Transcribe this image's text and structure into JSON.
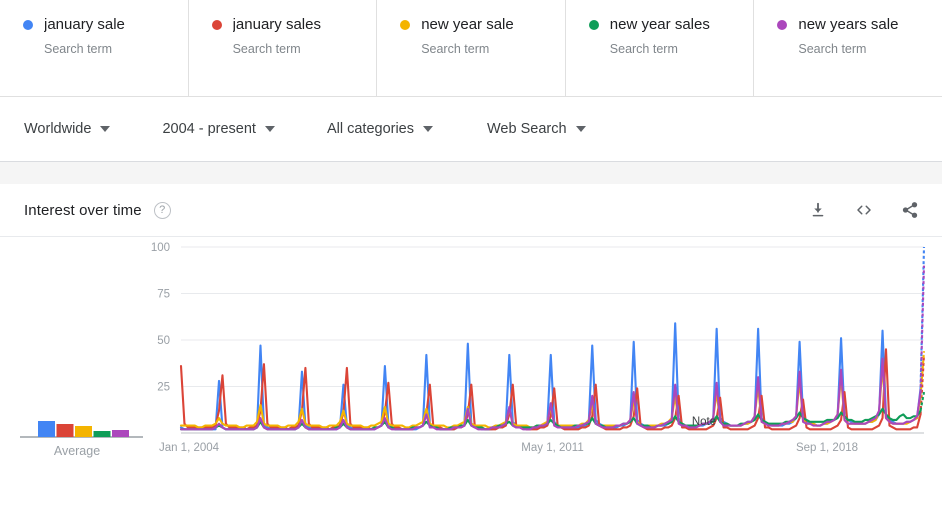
{
  "terms": [
    {
      "name": "january sale",
      "type": "Search term",
      "color": "#4285F4",
      "dot": "legend-dot"
    },
    {
      "name": "january sales",
      "type": "Search term",
      "color": "#DB4437",
      "dot": "legend-dot"
    },
    {
      "name": "new year sale",
      "type": "Search term",
      "color": "#F4B400",
      "dot": "legend-dot"
    },
    {
      "name": "new year sales",
      "type": "Search term",
      "color": "#0F9D58",
      "dot": "legend-dot"
    },
    {
      "name": "new years sale",
      "type": "Search term",
      "color": "#AB47BC",
      "dot": "legend-dot"
    }
  ],
  "filters": [
    {
      "label": "Worldwide",
      "icon": "chevron-down-icon"
    },
    {
      "label": "2004 - present",
      "icon": "chevron-down-icon"
    },
    {
      "label": "All categories",
      "icon": "chevron-down-icon"
    },
    {
      "label": "Web Search",
      "icon": "chevron-down-icon"
    }
  ],
  "card": {
    "title": "Interest over time",
    "help": "?",
    "actions": [
      {
        "name": "download-icon",
        "tooltip": "Download"
      },
      {
        "name": "embed-code-icon",
        "tooltip": "Embed"
      },
      {
        "name": "share-icon",
        "tooltip": "Share"
      }
    ]
  },
  "chart_data": {
    "type": "line",
    "title": "Interest over time",
    "xlabel": "",
    "ylabel": "",
    "ylim": [
      0,
      100
    ],
    "yticks": [
      25,
      50,
      75,
      100
    ],
    "grid": true,
    "legend_position": "top",
    "note_annotation": "Note",
    "axis_ticks": [
      "Jan 1, 2004",
      "May 1, 2011",
      "Sep 1, 2018"
    ],
    "x_start": "Jan 1, 2004",
    "x_end": "2021",
    "average_panel": {
      "label": "Average",
      "values": [
        16,
        13,
        11,
        6,
        7
      ]
    },
    "series": [
      {
        "name": "january sale",
        "color": "#4285F4",
        "peaks": [
          28,
          47,
          33,
          26,
          36,
          42,
          48,
          42,
          42,
          47,
          49,
          59,
          56,
          56,
          49,
          51,
          55,
          100
        ],
        "baseline": 3,
        "values": [
          3,
          2,
          2,
          3,
          2,
          2,
          2,
          2,
          2,
          2,
          2,
          28,
          3,
          2,
          2,
          2,
          2,
          2,
          2,
          2,
          2,
          2,
          3,
          47,
          4,
          3,
          2,
          2,
          2,
          2,
          2,
          2,
          2,
          2,
          3,
          33,
          4,
          3,
          2,
          2,
          2,
          2,
          2,
          2,
          2,
          2,
          3,
          26,
          4,
          3,
          2,
          2,
          2,
          2,
          2,
          2,
          2,
          3,
          4,
          36,
          5,
          3,
          2,
          2,
          2,
          2,
          2,
          2,
          2,
          3,
          4,
          42,
          5,
          3,
          3,
          2,
          2,
          2,
          2,
          2,
          3,
          3,
          4,
          48,
          5,
          4,
          3,
          2,
          2,
          2,
          2,
          3,
          3,
          3,
          5,
          42,
          6,
          4,
          3,
          3,
          2,
          2,
          3,
          3,
          3,
          4,
          5,
          42,
          6,
          4,
          3,
          3,
          3,
          3,
          3,
          3,
          4,
          4,
          6,
          47,
          7,
          5,
          4,
          3,
          3,
          3,
          3,
          4,
          4,
          5,
          6,
          49,
          7,
          5,
          4,
          3,
          3,
          3,
          4,
          4,
          4,
          5,
          7,
          59,
          8,
          5,
          4,
          4,
          3,
          3,
          4,
          4,
          5,
          5,
          7,
          56,
          8,
          6,
          5,
          4,
          4,
          4,
          4,
          5,
          5,
          6,
          8,
          56,
          8,
          6,
          5,
          4,
          4,
          4,
          4,
          5,
          5,
          6,
          8,
          49,
          9,
          6,
          5,
          5,
          4,
          4,
          5,
          5,
          6,
          7,
          9,
          51,
          9,
          7,
          6,
          5,
          5,
          5,
          5,
          6,
          6,
          7,
          10,
          55,
          10,
          7,
          6,
          5,
          5,
          5,
          6,
          6,
          7,
          8,
          24,
          100
        ]
      },
      {
        "name": "january sales",
        "color": "#DB4437",
        "peaks": [
          36,
          31,
          37,
          35,
          35,
          27,
          26,
          26,
          26,
          24,
          26,
          24,
          20,
          19,
          20,
          18,
          22,
          45
        ],
        "baseline": 3,
        "values": [
          36,
          5,
          3,
          3,
          3,
          3,
          3,
          3,
          3,
          3,
          4,
          12,
          31,
          5,
          3,
          3,
          3,
          3,
          3,
          2,
          3,
          3,
          4,
          12,
          37,
          5,
          3,
          3,
          3,
          3,
          3,
          2,
          3,
          3,
          4,
          12,
          35,
          5,
          3,
          3,
          3,
          3,
          3,
          2,
          3,
          3,
          4,
          11,
          35,
          5,
          3,
          3,
          3,
          3,
          3,
          2,
          3,
          3,
          4,
          11,
          27,
          5,
          3,
          3,
          2,
          2,
          2,
          2,
          3,
          3,
          4,
          10,
          26,
          4,
          3,
          3,
          2,
          2,
          2,
          2,
          3,
          3,
          4,
          10,
          26,
          4,
          3,
          3,
          2,
          2,
          2,
          2,
          3,
          3,
          4,
          10,
          26,
          4,
          3,
          3,
          2,
          2,
          2,
          2,
          3,
          3,
          4,
          9,
          24,
          4,
          3,
          2,
          2,
          2,
          2,
          2,
          3,
          3,
          4,
          9,
          26,
          4,
          3,
          2,
          2,
          2,
          2,
          2,
          3,
          3,
          4,
          9,
          24,
          4,
          3,
          2,
          2,
          2,
          2,
          2,
          3,
          3,
          4,
          8,
          20,
          3,
          3,
          2,
          2,
          2,
          2,
          2,
          2,
          3,
          4,
          8,
          19,
          3,
          3,
          2,
          2,
          2,
          2,
          2,
          2,
          3,
          4,
          8,
          20,
          3,
          3,
          2,
          2,
          2,
          2,
          2,
          2,
          3,
          4,
          8,
          18,
          3,
          2,
          2,
          2,
          2,
          2,
          2,
          2,
          3,
          4,
          7,
          22,
          3,
          2,
          2,
          2,
          2,
          2,
          2,
          2,
          3,
          4,
          8,
          45,
          4,
          3,
          2,
          2,
          2,
          2,
          2,
          3,
          3,
          10,
          42
        ]
      },
      {
        "name": "new year sale",
        "color": "#F4B400",
        "peaks": [
          8,
          15,
          13,
          12,
          14,
          13,
          14,
          13,
          14,
          16,
          18,
          20,
          22,
          25,
          28,
          30,
          36,
          44
        ],
        "baseline": 4,
        "values": [
          4,
          4,
          4,
          4,
          4,
          3,
          3,
          4,
          4,
          4,
          5,
          8,
          5,
          4,
          4,
          4,
          4,
          3,
          3,
          4,
          4,
          4,
          6,
          15,
          5,
          4,
          4,
          4,
          4,
          3,
          3,
          4,
          4,
          4,
          6,
          13,
          5,
          4,
          4,
          4,
          4,
          3,
          3,
          4,
          4,
          4,
          6,
          12,
          5,
          4,
          4,
          4,
          4,
          3,
          3,
          4,
          4,
          5,
          6,
          14,
          5,
          4,
          4,
          4,
          4,
          3,
          3,
          4,
          4,
          5,
          6,
          13,
          5,
          4,
          4,
          4,
          4,
          3,
          3,
          4,
          4,
          5,
          6,
          14,
          5,
          4,
          4,
          4,
          4,
          3,
          3,
          4,
          4,
          5,
          6,
          13,
          5,
          4,
          4,
          4,
          4,
          3,
          3,
          4,
          4,
          5,
          6,
          14,
          5,
          4,
          4,
          4,
          4,
          4,
          4,
          4,
          5,
          5,
          7,
          16,
          5,
          4,
          4,
          4,
          4,
          4,
          4,
          4,
          5,
          5,
          7,
          18,
          6,
          4,
          4,
          4,
          4,
          4,
          4,
          5,
          5,
          6,
          8,
          20,
          6,
          5,
          4,
          4,
          4,
          4,
          4,
          5,
          5,
          6,
          8,
          22,
          6,
          5,
          4,
          4,
          4,
          4,
          4,
          5,
          5,
          6,
          9,
          25,
          6,
          5,
          5,
          4,
          4,
          4,
          5,
          5,
          6,
          6,
          9,
          28,
          7,
          5,
          5,
          5,
          4,
          4,
          5,
          5,
          6,
          7,
          10,
          30,
          7,
          5,
          5,
          5,
          5,
          5,
          5,
          6,
          6,
          7,
          11,
          36,
          8,
          6,
          5,
          5,
          5,
          5,
          5,
          6,
          7,
          8,
          20,
          44
        ]
      },
      {
        "name": "new year sales",
        "color": "#0F9D58",
        "peaks": [
          4,
          6,
          5,
          5,
          6,
          6,
          7,
          6,
          7,
          8,
          8,
          9,
          9,
          10,
          11,
          11,
          13,
          22
        ],
        "baseline": 3,
        "values": [
          2,
          2,
          2,
          2,
          2,
          2,
          2,
          2,
          2,
          2,
          3,
          4,
          3,
          2,
          2,
          2,
          2,
          2,
          2,
          2,
          2,
          2,
          3,
          6,
          3,
          2,
          2,
          2,
          2,
          2,
          2,
          2,
          2,
          2,
          3,
          5,
          3,
          2,
          2,
          2,
          2,
          2,
          2,
          2,
          2,
          3,
          3,
          5,
          3,
          2,
          2,
          2,
          2,
          2,
          2,
          2,
          3,
          3,
          4,
          6,
          3,
          3,
          2,
          2,
          2,
          2,
          2,
          3,
          3,
          3,
          4,
          6,
          4,
          3,
          3,
          2,
          2,
          2,
          3,
          3,
          3,
          4,
          4,
          7,
          4,
          3,
          3,
          3,
          2,
          2,
          3,
          3,
          4,
          4,
          5,
          6,
          4,
          3,
          3,
          3,
          3,
          3,
          3,
          4,
          4,
          4,
          5,
          7,
          5,
          4,
          3,
          3,
          3,
          3,
          4,
          4,
          4,
          5,
          5,
          8,
          5,
          4,
          4,
          3,
          3,
          3,
          4,
          4,
          5,
          5,
          6,
          8,
          5,
          4,
          4,
          4,
          3,
          3,
          4,
          4,
          5,
          5,
          6,
          9,
          6,
          5,
          4,
          4,
          4,
          4,
          4,
          5,
          5,
          6,
          6,
          9,
          6,
          5,
          5,
          4,
          4,
          4,
          5,
          5,
          6,
          6,
          7,
          10,
          7,
          6,
          5,
          5,
          5,
          5,
          5,
          6,
          6,
          7,
          8,
          11,
          8,
          7,
          6,
          6,
          6,
          6,
          6,
          7,
          7,
          7,
          8,
          11,
          9,
          7,
          7,
          6,
          6,
          6,
          7,
          7,
          8,
          9,
          10,
          13,
          10,
          8,
          7,
          7,
          9,
          10,
          8,
          8,
          9,
          9,
          12,
          22
        ]
      },
      {
        "name": "new years sale",
        "color": "#AB47BC",
        "peaks": [
          5,
          8,
          7,
          7,
          8,
          10,
          13,
          14,
          16,
          20,
          22,
          26,
          27,
          30,
          33,
          34,
          40,
          90
        ],
        "baseline": 3,
        "values": [
          2,
          2,
          2,
          2,
          2,
          2,
          2,
          2,
          2,
          2,
          3,
          5,
          3,
          2,
          2,
          2,
          2,
          2,
          2,
          2,
          2,
          2,
          3,
          8,
          3,
          2,
          2,
          2,
          2,
          2,
          2,
          2,
          2,
          2,
          3,
          7,
          3,
          2,
          2,
          2,
          2,
          2,
          2,
          2,
          2,
          2,
          3,
          7,
          3,
          2,
          2,
          2,
          2,
          2,
          2,
          2,
          2,
          3,
          4,
          8,
          3,
          2,
          2,
          2,
          2,
          2,
          2,
          2,
          3,
          3,
          4,
          10,
          3,
          3,
          2,
          2,
          2,
          2,
          2,
          3,
          3,
          3,
          4,
          13,
          4,
          3,
          2,
          2,
          2,
          2,
          3,
          3,
          3,
          4,
          5,
          14,
          4,
          3,
          3,
          2,
          2,
          2,
          3,
          3,
          4,
          4,
          5,
          16,
          4,
          3,
          3,
          3,
          3,
          3,
          3,
          4,
          4,
          5,
          6,
          20,
          5,
          4,
          3,
          3,
          3,
          3,
          4,
          4,
          5,
          5,
          7,
          22,
          5,
          4,
          3,
          3,
          3,
          3,
          4,
          4,
          5,
          6,
          7,
          26,
          5,
          4,
          4,
          3,
          3,
          3,
          4,
          5,
          5,
          6,
          8,
          27,
          6,
          4,
          4,
          4,
          4,
          4,
          4,
          5,
          6,
          6,
          9,
          30,
          6,
          5,
          4,
          4,
          4,
          4,
          5,
          5,
          6,
          7,
          9,
          33,
          6,
          5,
          5,
          4,
          4,
          4,
          5,
          6,
          6,
          7,
          10,
          34,
          7,
          5,
          5,
          5,
          5,
          5,
          5,
          6,
          7,
          8,
          12,
          40,
          8,
          6,
          5,
          5,
          5,
          5,
          6,
          6,
          7,
          9,
          22,
          90
        ]
      }
    ]
  }
}
